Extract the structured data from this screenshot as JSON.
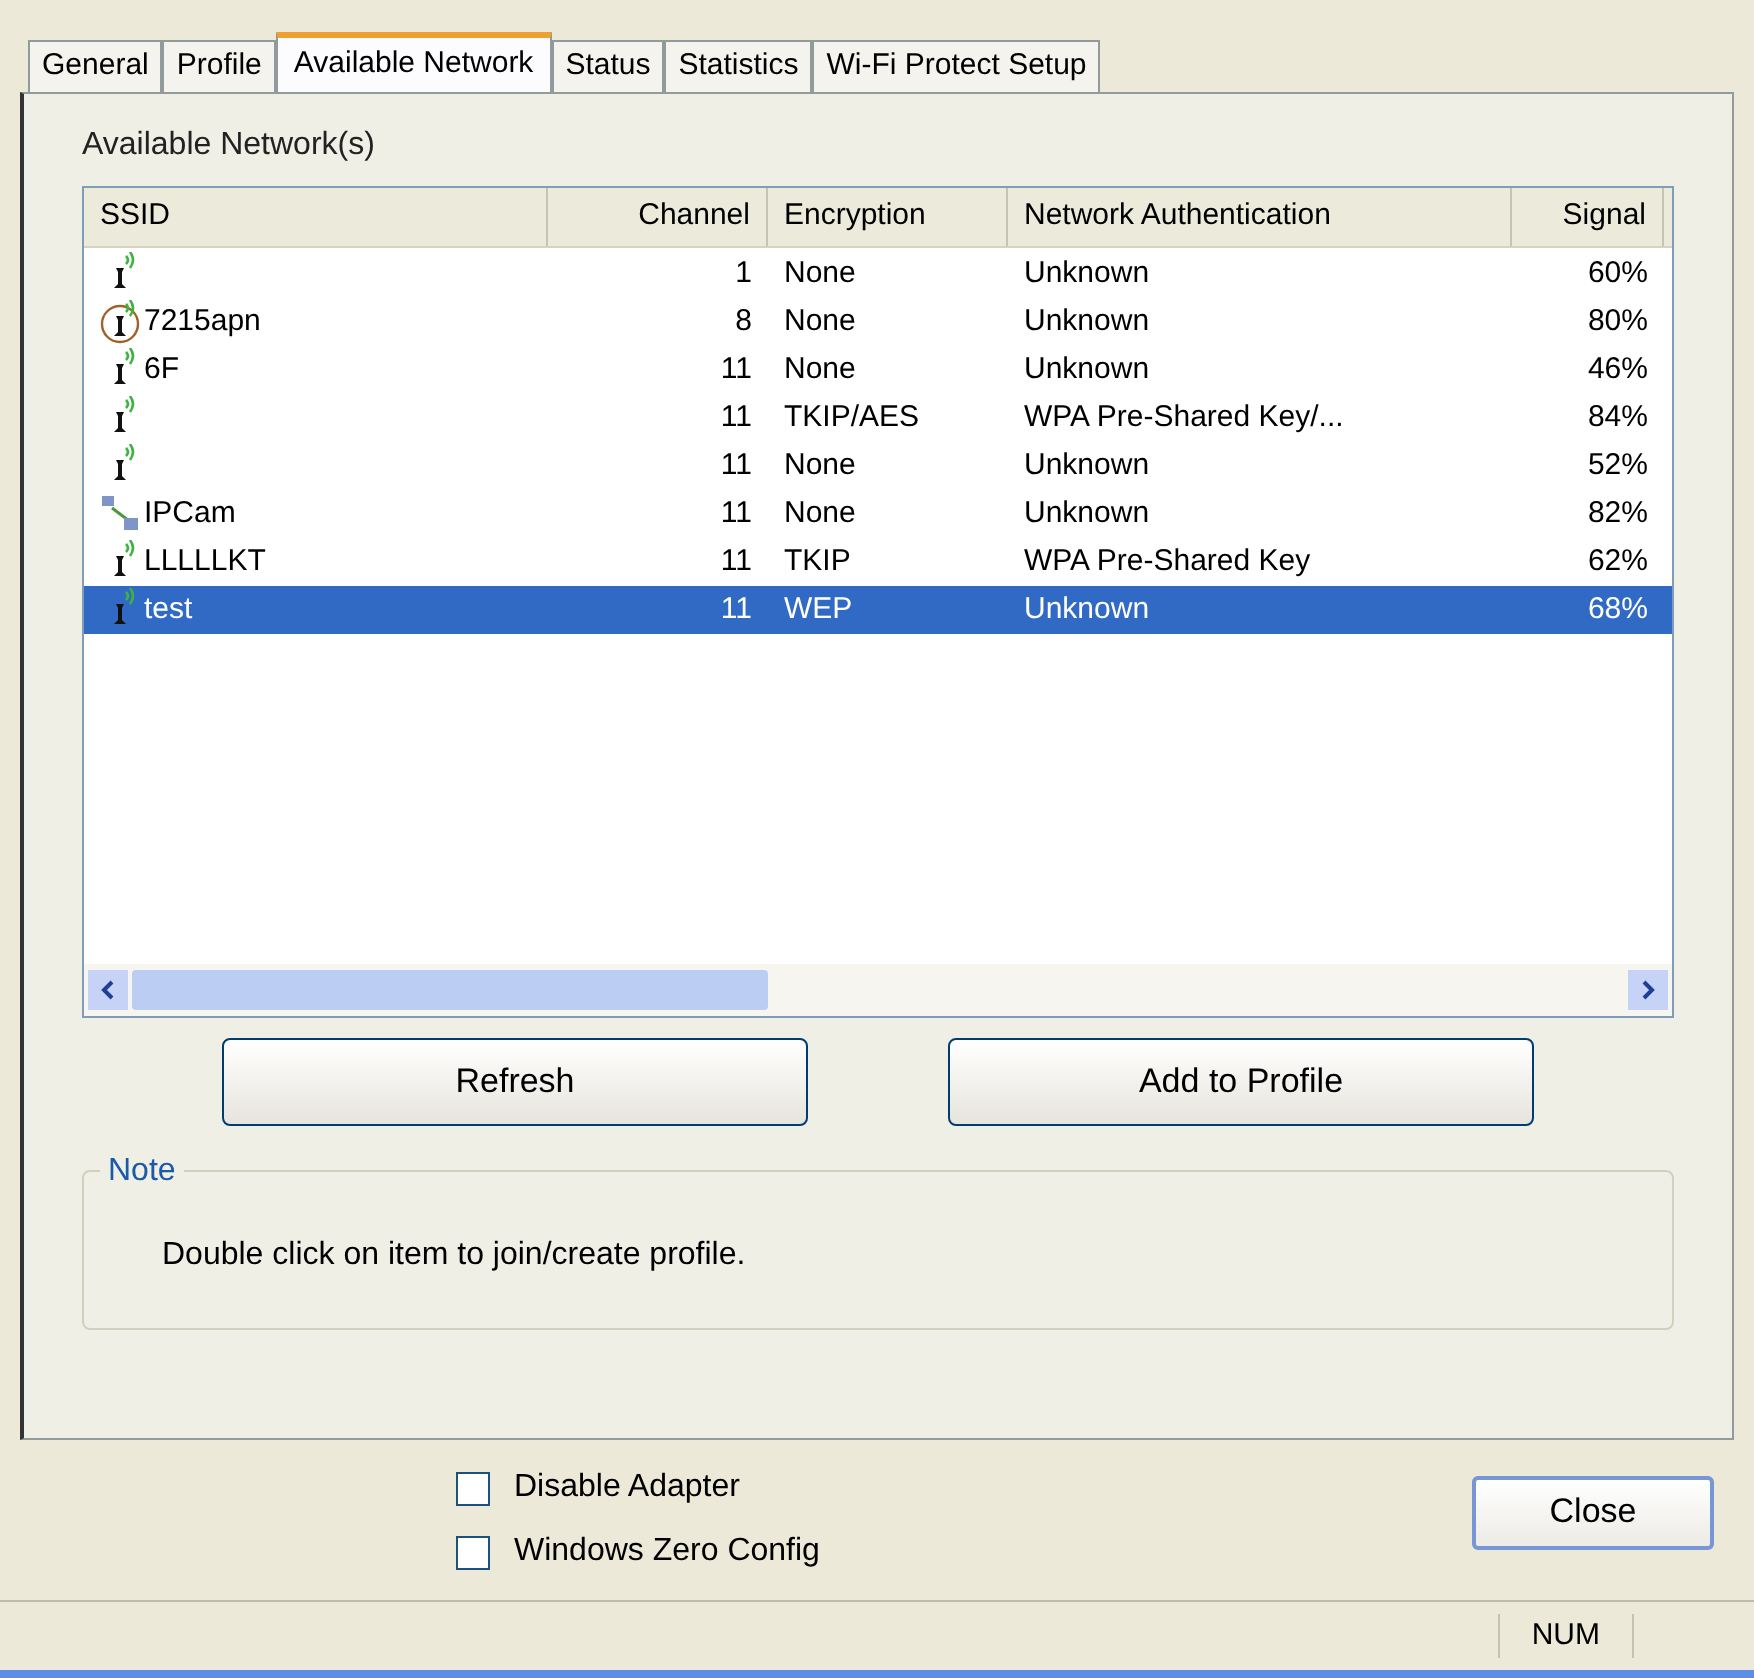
{
  "tabs": [
    {
      "label": "General",
      "selected": false
    },
    {
      "label": "Profile",
      "selected": false
    },
    {
      "label": "Available Network",
      "selected": true
    },
    {
      "label": "Status",
      "selected": false
    },
    {
      "label": "Statistics",
      "selected": false
    },
    {
      "label": "Wi-Fi Protect Setup",
      "selected": false
    }
  ],
  "group_title": "Available Network(s)",
  "table": {
    "columns": [
      "SSID",
      "Channel",
      "Encryption",
      "Network Authentication",
      "Signal"
    ],
    "rows": [
      {
        "kind": "ap",
        "selected": false,
        "cells": [
          "",
          "1",
          "None",
          "Unknown",
          "60%"
        ]
      },
      {
        "kind": "connected",
        "selected": false,
        "cells": [
          "7215apn",
          "8",
          "None",
          "Unknown",
          "80%"
        ]
      },
      {
        "kind": "ap",
        "selected": false,
        "cells": [
          "6F",
          "11",
          "None",
          "Unknown",
          "46%"
        ]
      },
      {
        "kind": "ap",
        "selected": false,
        "cells": [
          "",
          "11",
          "TKIP/AES",
          "WPA Pre-Shared Key/...",
          "84%"
        ]
      },
      {
        "kind": "ap",
        "selected": false,
        "cells": [
          "",
          "11",
          "None",
          "Unknown",
          "52%"
        ]
      },
      {
        "kind": "adhoc",
        "selected": false,
        "cells": [
          "IPCam",
          "11",
          "None",
          "Unknown",
          "82%"
        ]
      },
      {
        "kind": "ap",
        "selected": false,
        "cells": [
          "LLLLLKT",
          "11",
          "TKIP",
          "WPA Pre-Shared Key",
          "62%"
        ]
      },
      {
        "kind": "ap",
        "selected": true,
        "cells": [
          "test",
          "11",
          "WEP",
          "Unknown",
          "68%"
        ]
      }
    ]
  },
  "buttons": [
    "Refresh",
    "Add to Profile"
  ],
  "note": {
    "title": "Note",
    "text": "Double click on item to join/create profile."
  },
  "checkboxes": [
    {
      "label": "Disable Adapter",
      "checked": false
    },
    {
      "label": "Windows Zero Config",
      "checked": false
    }
  ],
  "close_button": "Close",
  "status_bar": {
    "indicator": "NUM"
  }
}
